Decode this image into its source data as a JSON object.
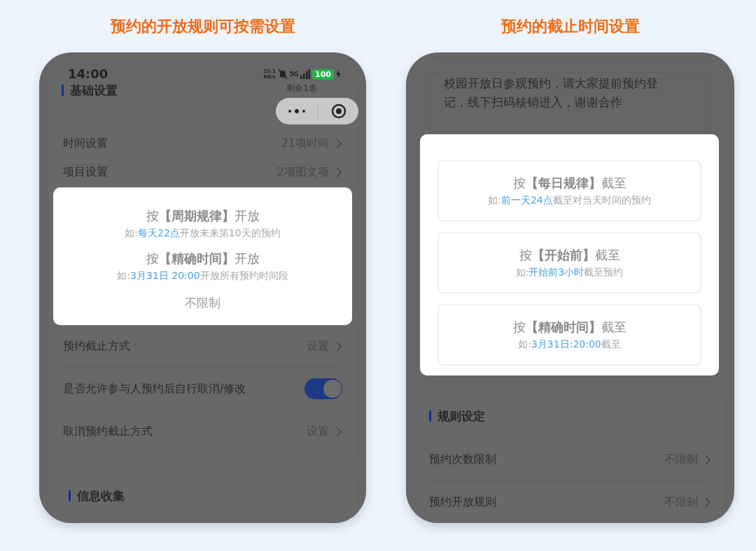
{
  "captions": [
    "预约的开放规则可按需设置",
    "预约的截止时间设置"
  ],
  "left_phone": {
    "status_bar": {
      "time": "14:00",
      "speed_value": "25.1",
      "speed_unit": "KB/s",
      "network": "5G",
      "battery": "100"
    },
    "behind_text": "剩余1名",
    "section_title": "基础设置",
    "rows_top": [
      {
        "label": "时间设置",
        "value": "21项时间"
      },
      {
        "label": "项目设置",
        "value": "2项图文项"
      }
    ],
    "popup": {
      "options": [
        {
          "title": "按**【周期规律】**开放",
          "example": {
            "prefix": "如:",
            "highlight": "每天22点",
            "suffix": "开放未来第10天的预约"
          }
        },
        {
          "title": "按**【精确时间】**开放",
          "example": {
            "prefix": "如:",
            "highlight": "3月31日 20:00",
            "suffix": "开放所有预约时间段"
          }
        }
      ],
      "no_limit": "不限制"
    },
    "rows_bottom": [
      {
        "kind": "link",
        "label": "预约截止方式",
        "value": "设置"
      },
      {
        "kind": "toggle",
        "label": "是否允许参与人预约后自行取消/修改",
        "on": true
      },
      {
        "kind": "link",
        "label": "取消预约截止方式",
        "value": "设置"
      }
    ],
    "next_section_title": "信息收集"
  },
  "right_phone": {
    "description": "校园开放日参观预约，请大家提前预约登记，线下扫码核销进入，谢谢合作",
    "popup": {
      "options": [
        {
          "title": "按**【每日规律】**截至",
          "example": {
            "prefix": "如:",
            "highlight": "前一天24点",
            "suffix": "截至对当天时间的预约"
          }
        },
        {
          "title": "按**【开始前】**截至",
          "example": {
            "prefix": "如:",
            "highlight": "开始前3小时",
            "suffix": "截至预约"
          }
        },
        {
          "title": "按**【精确时间】**截至",
          "example": {
            "prefix": "如:",
            "highlight": "3月31日:20:00",
            "suffix": "截至"
          }
        }
      ]
    },
    "section_title": "规则设定",
    "rows": [
      {
        "label": "预约次数限制",
        "value": "不限制"
      },
      {
        "label": "预约开放规则",
        "value": "不限制"
      }
    ]
  }
}
